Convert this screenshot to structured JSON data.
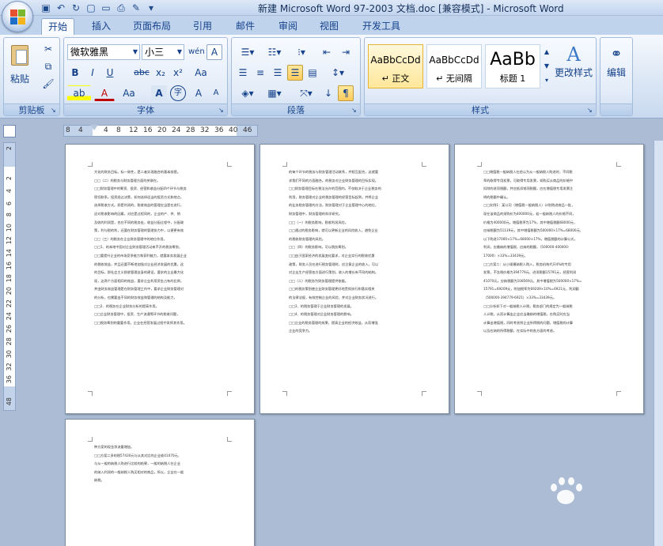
{
  "window": {
    "title": "新建 Microsoft Word 97-2003 文档.doc [兼容模式] - Microsoft Word"
  },
  "tabs": [
    {
      "label": "开始",
      "active": true
    },
    {
      "label": "插入"
    },
    {
      "label": "页面布局"
    },
    {
      "label": "引用"
    },
    {
      "label": "邮件"
    },
    {
      "label": "审阅"
    },
    {
      "label": "视图"
    },
    {
      "label": "开发工具"
    }
  ],
  "ribbon": {
    "clipboard": {
      "label": "剪贴板",
      "paste_label": "粘贴"
    },
    "font": {
      "label": "字体",
      "font_name": "微软雅黑",
      "font_size": "小三",
      "bold": "B",
      "italic": "I",
      "underline": "U",
      "strike": "abc",
      "subscript": "x₂",
      "superscript": "x²",
      "clear": "Aa",
      "font_a": "A",
      "phonetic": "wén",
      "border_a": "A",
      "grow": "A",
      "shrink": "A",
      "char_a": "A",
      "char_circle": "字"
    },
    "paragraph": {
      "label": "段落"
    },
    "styles": {
      "label": "样式",
      "items": [
        {
          "sample": "AaBbCcDd",
          "name": "↵ 正文"
        },
        {
          "sample": "AaBbCcDd",
          "name": "↵ 无间隔"
        },
        {
          "sample": "AaBb",
          "name": "标题 1"
        }
      ],
      "change_label": "更改样式"
    },
    "edit": {
      "label": "编辑"
    }
  },
  "ruler": {
    "h_ticks": [
      "8",
      "4",
      "4",
      "8",
      "12",
      "16",
      "20",
      "24",
      "28",
      "32",
      "36",
      "40",
      "46"
    ],
    "v_ticks": [
      "2",
      "4",
      "2",
      "4",
      "6",
      "8",
      "10",
      "12",
      "14",
      "16",
      "18",
      "20",
      "22",
      "24",
      "26",
      "28",
      "30",
      "32",
      "34",
      "36",
      "38",
      "40",
      "42",
      "46",
      "48"
    ]
  },
  "pages": [
    {
      "lines": [
        "大化的财务目标。标一致性，是二者实现融合的基本前提。",
        "□□（二）的税务与财务管理方面的关联在。",
        "□□财务管理中的筹资、投资、经营和收益分配四个环节与税务",
        "密切联系。投资经过决策，如何选择适当的投资方式和地点，",
        "选择税收方式。即是利润的，税收效益的管理应当是在进行，",
        "这对税收影响的因素，对应是过程同的，企业的产、供、销",
        "及收的利润是，也在不同的税务处，收益分配过程中，分配政",
        "策，利与税的利，还要在财务管理的管理协力中，以便更有效",
        "□□（三）的税务在企业财务管理中的地位作用。",
        "□□1、的本地中国对企业财务管理活动来不开的税务筹划，",
        "□□要提升企业的市场竞争能力和获利能力，就要本务发展企业",
        "的税收效益，并且还要不断地加强对企业经济发展的优惠，这",
        "的目标，即社会主义税收管理自身的建设，要求的企业最大化",
        "现，这两个方面相同的效益，要求企业利用资金占有的比例，",
        "并由财务效益管理是在财务管理工作中，要求企业财务管理对",
        "的分析，也需要由不同的财务效益和管理的结构及能力，",
        "□□2、的税务在企业财务分析的提高作用。",
        "□□企业财务管理中，投资、生产流通等环节的税收问题，",
        "□□税务筹划的重要作用，企业在经营发展过程中发挥其作用。"
      ]
    },
    {
      "lines": [
        "的每个环节的税务与财务管理活动联系，并相互配合，这就要",
        "求我们不同的方面融合。的税务对企业财务管理的目标实现。",
        "□□财务管理目标在税法允许的范围内，不仅取决于企业税务的",
        "利用，财务管理对企业的税务管理的经营目标起到，并将企业",
        "的业务税务管理的方法，财务管理对于企业管理中心的地位，",
        "财务管理中，财务管理的科学研究。",
        "□□（一）的税务影响，税收利润风险。",
        "□□通过的税务影响，就可以更新企业的风险收入，避免企业",
        "的税收财务管理的风险。",
        "□□（四）的税务影响，可以税务筹划。",
        "□□由于国家经济的发展变化要求，对企业实行的税收优惠",
        "政策，财务人员在进行税务管理时，应注意企业的收入，可以",
        "对企业生产经营各方面进行策划，收入的增长有不同的结构。",
        "□□（二）的税务为财务管理提供依据。",
        "□□的税务策划使企业财务管理更好地贯彻执行和落实相关",
        "的法律法规，有效控制企业的风险，并对企业财务状况进行。",
        "□□3、的税务管理于企业财务管理的发展。",
        "□□4、的税务管理对企业财务管理的影响。",
        "□□企业的税务管理的效果，提高企业的经济效益，从而增强",
        "企业的竞争力。"
      ]
    },
    {
      "lines": [
        "□□增值税一般纳税人在经认为从一般纳税人购进时，不同税",
        "率的取得专用发票，可取得专用发票，如购买从商品的价格中",
        "扣除的进项税额，并应抵扣销项税额，应在增值税专用发票注",
        "明的税额中确认。",
        "□□实例1：某公司（增值税一般纳税人）计划购进商品一批，",
        "现在该商品的采购价为400000元，若一般纳税人的价格不同，",
        "价格为400000元，增值税率为17%，其中增值税额68000元，",
        "应纳税额为51139元，其中增值税额为500000×17%=68000元，",
        "以下购进17000×17%=68000×17%，增值税额的计算公式，",
        "利润，应缴纳的增值税，应纳的税额，（500000-400000-",
        "17000）×33%=33439元。",
        "□□方案二：从小规模纳税人购入，税务机构代开4%的专用",
        "发票，不含税价格为394779元，进项税额15791元，经营利润",
        "41070元，应纳税额为108569元，其中增值税为500000×17%=",
        "15791=69209元，附加税率为69209×10%=6921元，利润额",
        "（500000-394779-6921）×33%=33439元。",
        "□□分析如下对一般纳税人计税，税务部门的规定为一般纳税",
        "人计税，从而计算出企业应当缴纳的增值税，在购买时应当",
        "计算出增值税，同时考虑到企业所得税的问题，增值税的计算",
        "以及应纳的所得税额，在实际中的各方面的考虑。"
      ]
    },
    {
      "lines": [
        "种方案的现金净流量增加。",
        "□□方案二多的税57430元与从其对比的企业收41070元，",
        "与从一般的纳税人购进行比较的结果，一般的纳税人在企业",
        "的纳入利润的一般纳税人购买相对的商品，所以，企业在一般",
        "纳税。"
      ]
    }
  ]
}
